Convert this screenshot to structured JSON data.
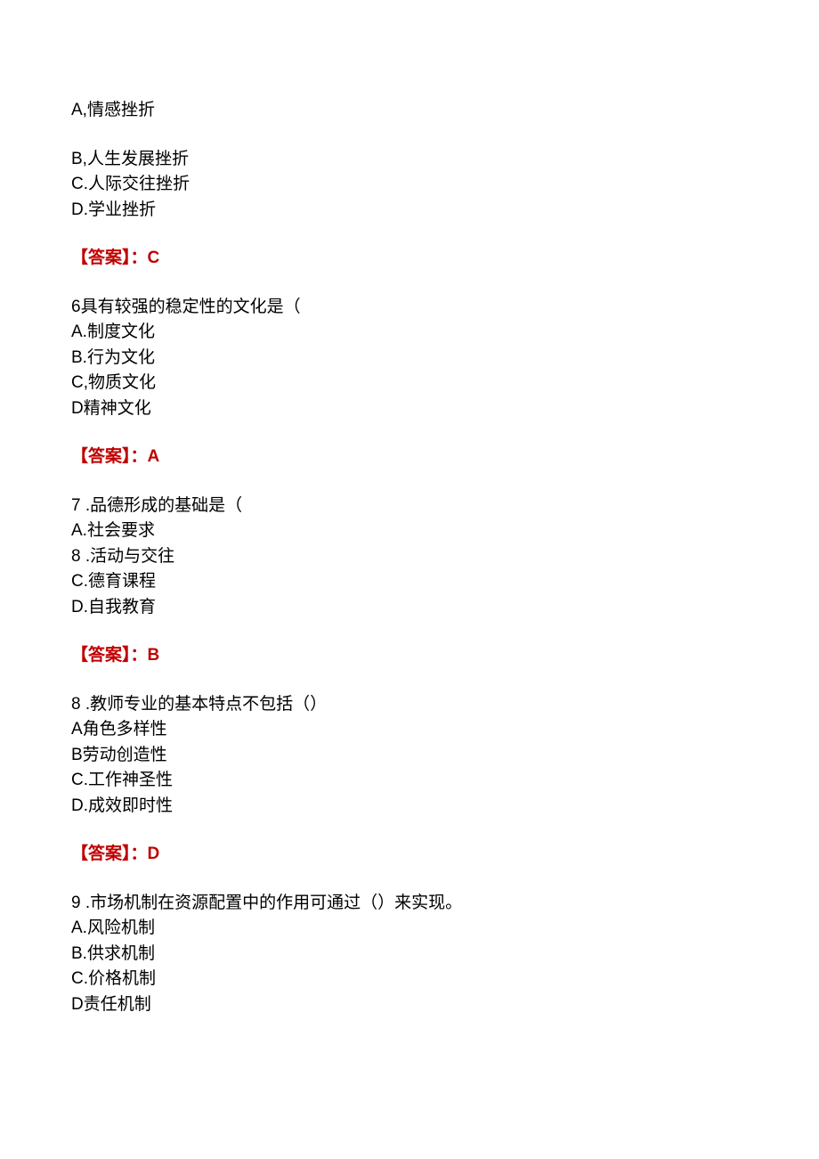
{
  "q5_continued": {
    "optA": "A,情感挫折",
    "optB": "B,人生发展挫折",
    "optC": "C.人际交往挫折",
    "optD": "D.学业挫折",
    "answer_label": "【答案】：",
    "answer_value": "C"
  },
  "q6": {
    "stem": "6具有较强的稳定性的文化是（",
    "optA": "A.制度文化",
    "optB": "B.行为文化",
    "optC": "C,物质文化",
    "optD": "D精神文化",
    "answer_label": "【答案】：",
    "answer_value": "A"
  },
  "q7": {
    "stem": "7  .品德形成的基础是（",
    "optA": "A.社会要求",
    "optB": "8  .活动与交往",
    "optC": "C.德育课程",
    "optD": "D.自我教育",
    "answer_label": "【答案】：",
    "answer_value": "B"
  },
  "q8": {
    "stem": "8  .教师专业的基本特点不包括（）",
    "optA": "A角色多样性",
    "optB": "B劳动创造性",
    "optC": "C.工作神圣性",
    "optD": "D.成效即时性",
    "answer_label": "【答案】：",
    "answer_value": "D"
  },
  "q9": {
    "stem": "9  .市场机制在资源配置中的作用可通过（）来实现。",
    "optA": "A.风险机制",
    "optB": "B.供求机制",
    "optC": "C.价格机制",
    "optD": "D责任机制"
  }
}
